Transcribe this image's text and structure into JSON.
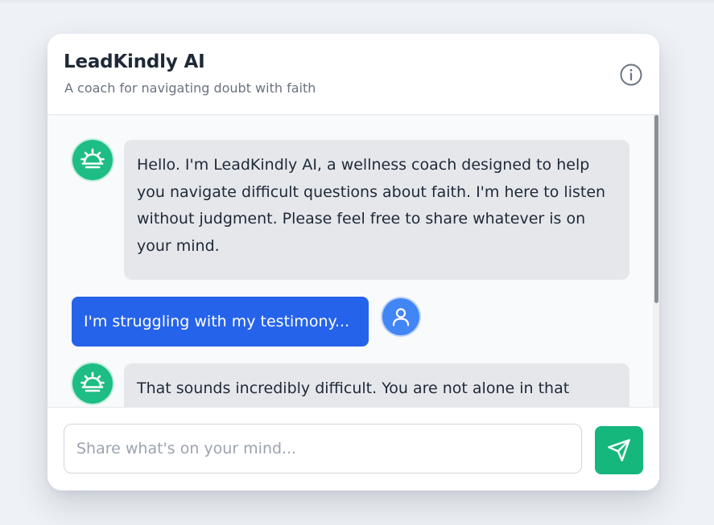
{
  "header": {
    "title": "LeadKindly AI",
    "subtitle": "A coach for navigating doubt with faith",
    "info_icon": "info-icon"
  },
  "messages": [
    {
      "sender": "bot",
      "avatar_icon": "sunrise-icon",
      "text": "Hello. I'm LeadKindly AI, a wellness coach designed to help you navigate difficult questions about faith. I'm here to listen without judgment. Please feel free to share whatever is on your mind."
    },
    {
      "sender": "user",
      "avatar_icon": "user-icon",
      "text": "I'm struggling with my testimony..."
    },
    {
      "sender": "bot",
      "avatar_icon": "sunrise-icon",
      "text": "That sounds incredibly difficult. You are not alone in that"
    }
  ],
  "composer": {
    "placeholder": "Share what's on your mind...",
    "value": "",
    "send_icon": "send-icon"
  },
  "colors": {
    "bot_accent": "#1ebd85",
    "user_bubble": "#2563eb",
    "user_avatar": "#4285f4",
    "bot_bubble": "#e5e7eb",
    "send_button": "#16b77d"
  }
}
